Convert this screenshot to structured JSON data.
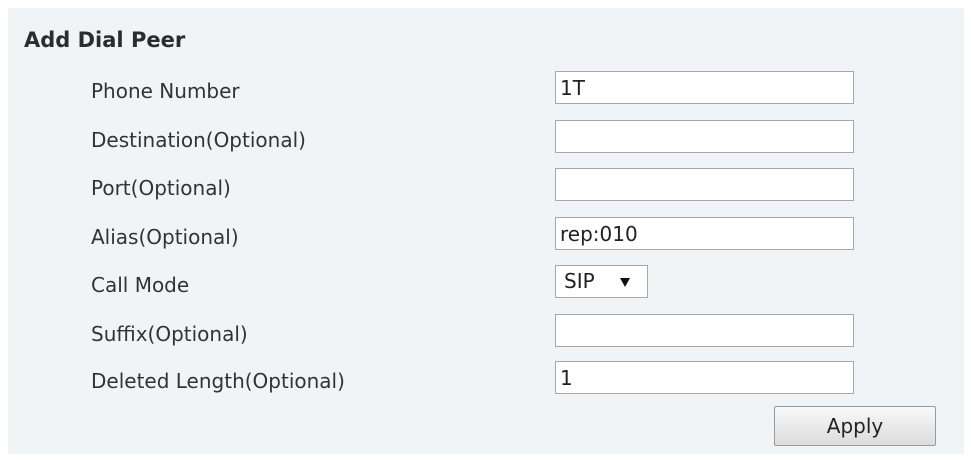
{
  "panel": {
    "title": "Add Dial Peer"
  },
  "fields": {
    "phone_number": {
      "label": "Phone Number",
      "value": "1T"
    },
    "destination": {
      "label": "Destination(Optional)",
      "value": ""
    },
    "port": {
      "label": "Port(Optional)",
      "value": ""
    },
    "alias": {
      "label": "Alias(Optional)",
      "value": "rep:010"
    },
    "call_mode": {
      "label": "Call Mode",
      "value": "SIP"
    },
    "suffix": {
      "label": "Suffix(Optional)",
      "value": ""
    },
    "deleted_length": {
      "label": "Deleted Length(Optional)",
      "value": "1"
    }
  },
  "actions": {
    "apply_label": "Apply"
  }
}
